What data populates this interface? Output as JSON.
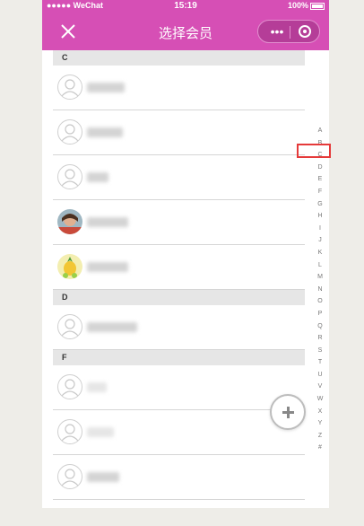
{
  "status_bar": {
    "carrier": "●●●●● WeChat",
    "time": "15:19",
    "battery": "100%"
  },
  "nav": {
    "title": "选择会员",
    "more_label": "•••"
  },
  "sections": [
    {
      "letter": "C",
      "rows": [
        {
          "avatar": "placeholder"
        },
        {
          "avatar": "placeholder"
        },
        {
          "avatar": "placeholder"
        },
        {
          "avatar": "photo-person"
        },
        {
          "avatar": "photo-pineapple"
        }
      ]
    },
    {
      "letter": "D",
      "rows": [
        {
          "avatar": "placeholder"
        }
      ]
    },
    {
      "letter": "F",
      "rows": [
        {
          "avatar": "placeholder"
        },
        {
          "avatar": "placeholder"
        },
        {
          "avatar": "placeholder"
        }
      ]
    }
  ],
  "index_letters": [
    "A",
    "B",
    "C",
    "D",
    "E",
    "F",
    "G",
    "H",
    "I",
    "J",
    "K",
    "L",
    "M",
    "N",
    "O",
    "P",
    "Q",
    "R",
    "S",
    "T",
    "U",
    "V",
    "W",
    "X",
    "Y",
    "Z",
    "#"
  ],
  "highlighted_index": "C",
  "colors": {
    "brand": "#d64fb5",
    "highlight": "#e53a3a"
  },
  "icons": {
    "close": "close-icon",
    "more": "more-icon",
    "target": "target-icon",
    "add": "plus-icon"
  }
}
